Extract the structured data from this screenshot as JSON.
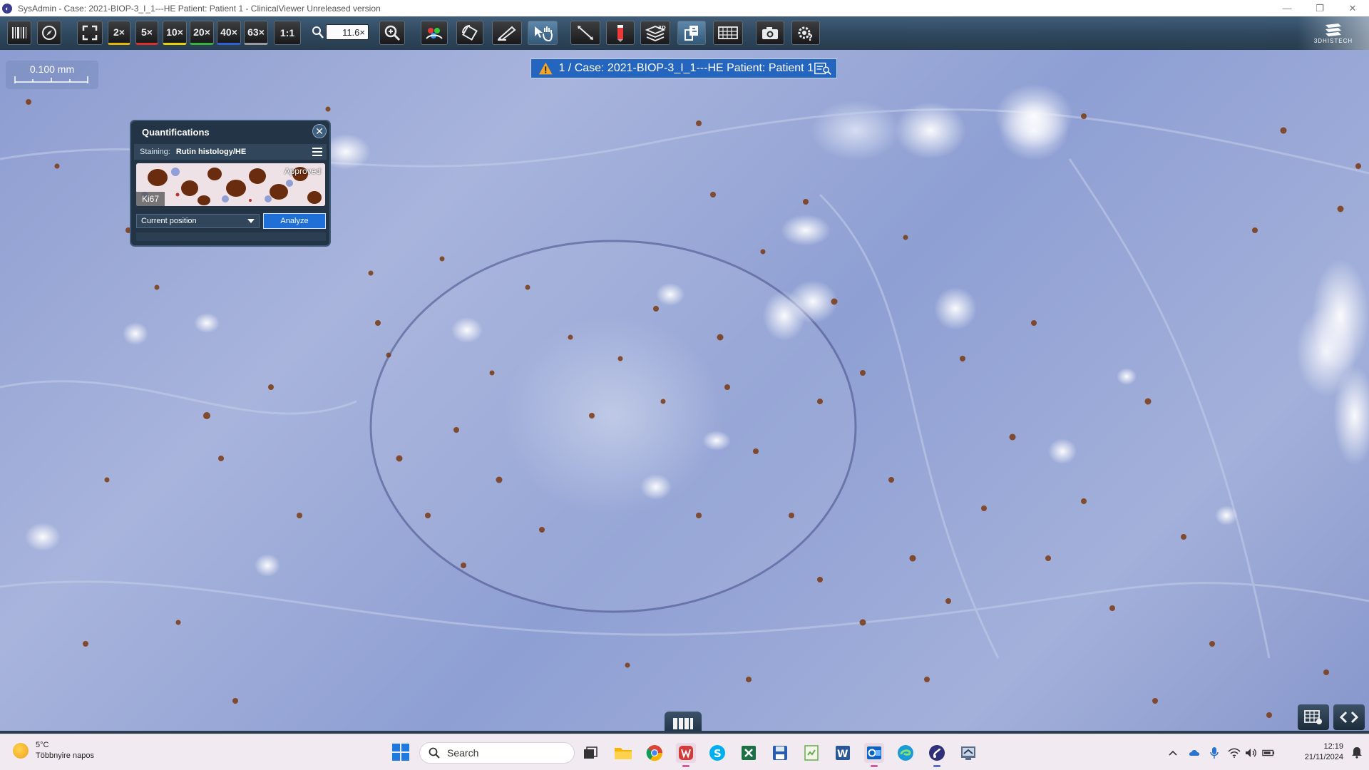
{
  "window": {
    "title": "SysAdmin - Case: 2021-BIOP-3_I_1---HE Patient: Patient 1 - ClinicalViewer Unreleased version",
    "controls": [
      "minimize",
      "restore",
      "close"
    ]
  },
  "toolbar": {
    "magnifications": [
      "2×",
      "5×",
      "10×",
      "20×",
      "40×",
      "63×"
    ],
    "one_to_one": "1:1",
    "zoom_value": "11.6×",
    "brand": "3DHISTECH",
    "icons": [
      "barcode-icon",
      "navigator-icon",
      "fullscreen-icon",
      "zoom-icon",
      "color-icon",
      "rotate-icon",
      "annotation-icon",
      "pan-hand-icon",
      "measure-icon",
      "marker-icon",
      "layers-3d-icon",
      "export-icon",
      "grid-icon",
      "camera-icon",
      "settings-help-icon"
    ]
  },
  "scalebar": {
    "label": "0.100 mm"
  },
  "case_banner": {
    "text": "1 / Case: 2021-BIOP-3_I_1---HE Patient: Patient 1"
  },
  "quantifications": {
    "title": "Quantifications",
    "staining_label": "Staining:",
    "staining_value": "Rutin histology/HE",
    "thumbnail_status": "Approved",
    "thumbnail_marker": "Ki67",
    "position_select": "Current position",
    "analyze_label": "Analyze"
  },
  "taskbar": {
    "weather_temp": "5°C",
    "weather_desc": "Többnyire napos",
    "search_placeholder": "Search",
    "apps": [
      "task-view",
      "file-explorer",
      "chrome",
      "slide-app",
      "skype",
      "excel",
      "save-app",
      "notes-app",
      "word",
      "outlook",
      "edge",
      "caseviewer",
      "admin-tool"
    ],
    "time": "12:19",
    "date": "21/11/2024"
  },
  "colors": {
    "toolbar": "#2a4358",
    "banner": "#2466bf",
    "panel": "#223445",
    "hematoxylin": "#8b9bd0",
    "dab": "#7a3a12"
  }
}
